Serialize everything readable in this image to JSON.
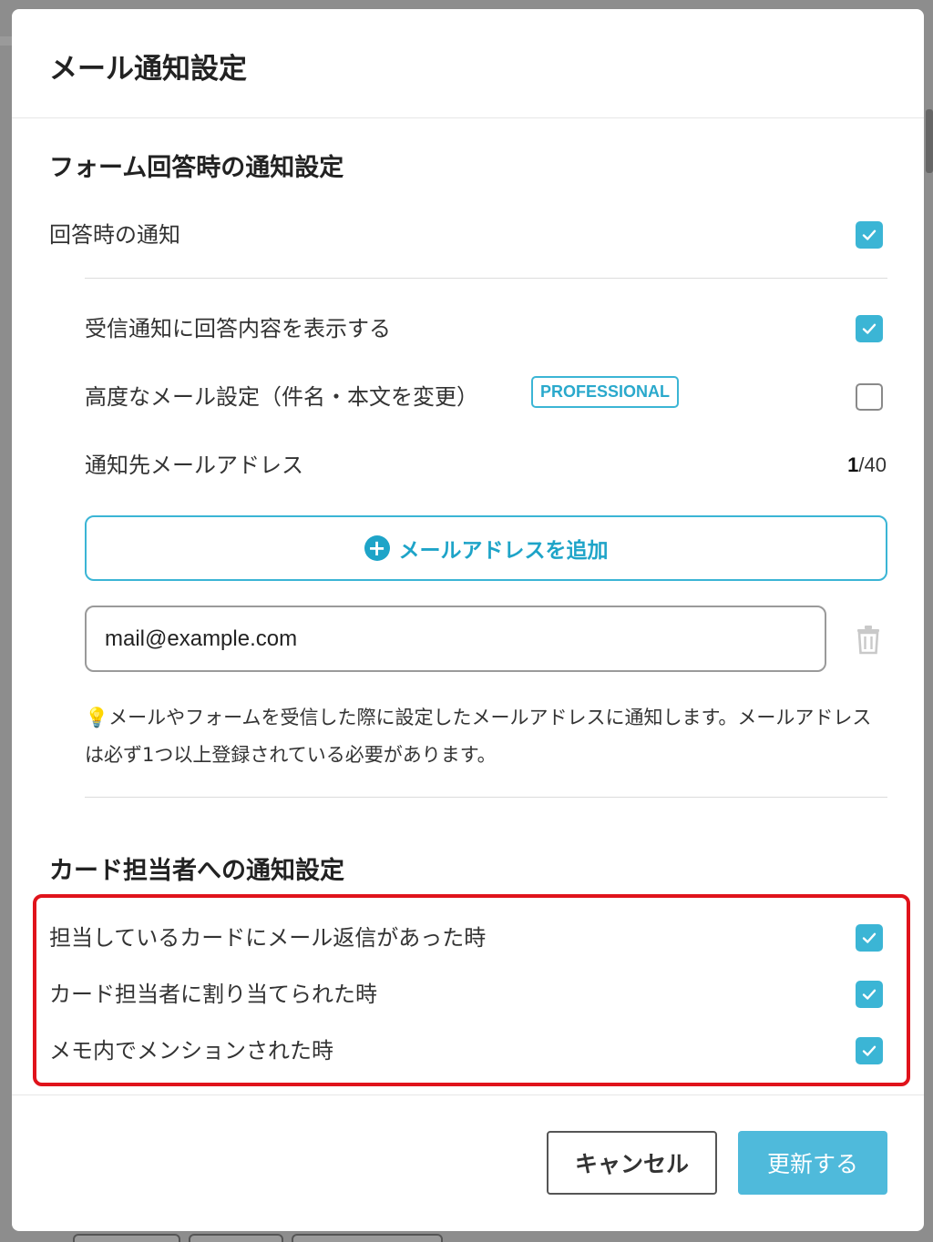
{
  "modal": {
    "title": "メール通知設定"
  },
  "form_section": {
    "title": "フォーム回答時の通知設定",
    "answer_notify": {
      "label": "回答時の通知",
      "checked": true
    },
    "show_content": {
      "label": "受信通知に回答内容を表示する",
      "checked": true
    },
    "advanced_mail": {
      "label": "高度なメール設定（件名・本文を変更）",
      "badge": "PROFESSIONAL",
      "checked": false
    },
    "recipients": {
      "label": "通知先メールアドレス",
      "count": "1",
      "max": "/40",
      "add_button_label": "メールアドレスを追加",
      "addresses": [
        "mail@example.com"
      ]
    },
    "note": "💡メールやフォームを受信した際に設定したメールアドレスに通知します。メールアドレスは必ず1つ以上登録されている必要があります。"
  },
  "card_section": {
    "title": "カード担当者への通知設定",
    "items": [
      {
        "label": "担当しているカードにメール返信があった時",
        "checked": true
      },
      {
        "label": "カード担当者に割り当てられた時",
        "checked": true
      },
      {
        "label": "メモ内でメンションされた時",
        "checked": true
      }
    ]
  },
  "footer": {
    "cancel_label": "キャンセル",
    "submit_label": "更新する"
  },
  "colors": {
    "accent": "#3bb5d5",
    "highlight": "#e0131b"
  },
  "icons": [
    "check-icon",
    "plus-circle-icon",
    "trash-icon",
    "lightbulb-icon"
  ]
}
